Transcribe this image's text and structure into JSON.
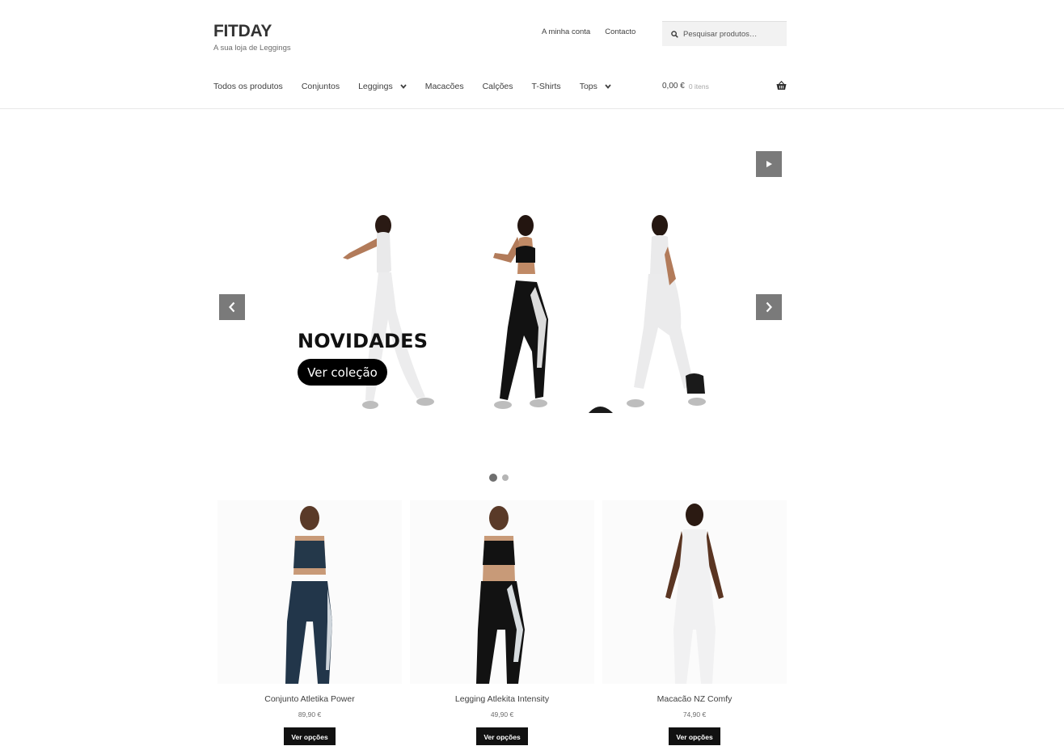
{
  "header": {
    "site_title": "FITDAY",
    "tagline": "A sua loja de Leggings",
    "secondary_nav": [
      "A minha conta",
      "Contacto"
    ],
    "search_placeholder": "Pesquisar produtos…",
    "icons": {
      "search": "search-icon",
      "cart": "basket-icon"
    }
  },
  "primary_nav": {
    "items": [
      {
        "label": "Todos os produtos",
        "dropdown": false
      },
      {
        "label": "Conjuntos",
        "dropdown": false
      },
      {
        "label": "Leggings",
        "dropdown": true
      },
      {
        "label": "Macacões",
        "dropdown": false
      },
      {
        "label": "Calções",
        "dropdown": false
      },
      {
        "label": "T-Shirts",
        "dropdown": false
      },
      {
        "label": "Tops",
        "dropdown": true
      }
    ]
  },
  "cart": {
    "total": "0,00 €",
    "count": "0 itens"
  },
  "slider": {
    "heading": "NOVIDADES",
    "cta": "Ver coleção",
    "active_slide": 1,
    "slide_count": 2,
    "controls": [
      "play-icon",
      "chevron-left-icon",
      "chevron-right-icon"
    ]
  },
  "products": [
    {
      "title": "Conjunto Atletika Power",
      "price": "89,90 €",
      "button": "Ver opções"
    },
    {
      "title": "Legging Atlekita Intensity",
      "price": "49,90 €",
      "button": "Ver opções"
    },
    {
      "title": "Macacão NZ Comfy",
      "price": "74,90 €",
      "button": "Ver opções"
    }
  ],
  "colors": {
    "text": "#404040",
    "control_bg": "#7a7a7a",
    "button_bg": "#111111",
    "search_bg": "#f2f2f2"
  }
}
